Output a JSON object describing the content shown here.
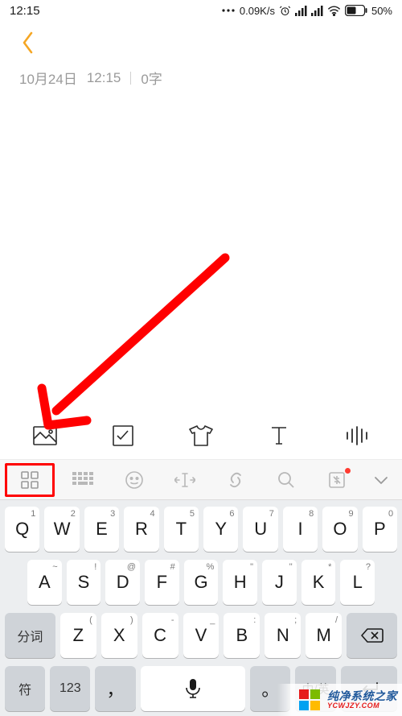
{
  "status": {
    "time": "12:15",
    "menu_icon": "more-icon",
    "speed": "0.09K/s",
    "battery_pct": "50%"
  },
  "note": {
    "date": "10月24日",
    "time": "12:15",
    "char_count": "0字"
  },
  "app_toolbar": {
    "items": [
      "image-icon",
      "checkbox-icon",
      "shirt-icon",
      "text-style-icon",
      "voice-wave-icon"
    ]
  },
  "ime_toolbar": {
    "grid_icon": "app-grid-icon",
    "items": [
      "keyboard-layout-icon",
      "emoji-icon",
      "cursor-move-icon",
      "link-icon",
      "search-icon",
      "coupon-icon"
    ],
    "collapse_icon": "chevron-down-icon"
  },
  "keyboard": {
    "row1": [
      {
        "sub": "1",
        "main": "Q"
      },
      {
        "sub": "2",
        "main": "W"
      },
      {
        "sub": "3",
        "main": "E"
      },
      {
        "sub": "4",
        "main": "R"
      },
      {
        "sub": "5",
        "main": "T"
      },
      {
        "sub": "6",
        "main": "Y"
      },
      {
        "sub": "7",
        "main": "U"
      },
      {
        "sub": "8",
        "main": "I"
      },
      {
        "sub": "9",
        "main": "O"
      },
      {
        "sub": "0",
        "main": "P"
      }
    ],
    "row2": [
      {
        "sub": "~",
        "main": "A"
      },
      {
        "sub": "!",
        "main": "S"
      },
      {
        "sub": "@",
        "main": "D"
      },
      {
        "sub": "#",
        "main": "F"
      },
      {
        "sub": "%",
        "main": "G"
      },
      {
        "sub": "\"",
        "main": "H"
      },
      {
        "sub": "\"",
        "main": "J"
      },
      {
        "sub": "*",
        "main": "K"
      },
      {
        "sub": "?",
        "main": "L"
      }
    ],
    "row3_shift_label": "分词",
    "row3": [
      {
        "sub": "(",
        "main": "Z"
      },
      {
        "sub": ")",
        "main": "X"
      },
      {
        "sub": "-",
        "main": "C"
      },
      {
        "sub": "_",
        "main": "V"
      },
      {
        "sub": ":",
        "main": "B"
      },
      {
        "sub": ";",
        "main": "N"
      },
      {
        "sub": "/",
        "main": "M"
      }
    ],
    "row4": {
      "sym": "符",
      "num": "123",
      "comma": "，",
      "space_icon": "mic-icon",
      "period": "。",
      "lang": "中/英",
      "enter_icon": "enter-icon"
    }
  },
  "annotation_arrow": "red-arrow",
  "watermark": {
    "top": "纯净系统之家",
    "bottom": "YCWJZY.COM"
  }
}
